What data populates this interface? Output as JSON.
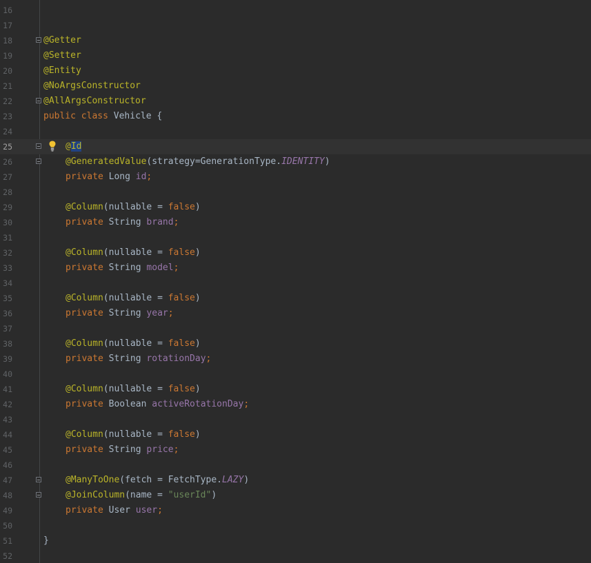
{
  "editor": {
    "current_line": "25",
    "lines": [
      {
        "num": "16",
        "text": ""
      },
      {
        "num": "17",
        "text": ""
      },
      {
        "num": "18",
        "annotation": "@Getter"
      },
      {
        "num": "19",
        "annotation": "@Setter"
      },
      {
        "num": "20",
        "annotation": "@Entity"
      },
      {
        "num": "21",
        "annotation": "@NoArgsConstructor"
      },
      {
        "num": "22",
        "annotation": "@AllArgsConstructor"
      },
      {
        "num": "23",
        "kw1": "public",
        "kw2": "class",
        "name": "Vehicle {"
      },
      {
        "num": "24",
        "text": ""
      },
      {
        "num": "25",
        "at": "@",
        "sel": "Id"
      },
      {
        "num": "26",
        "annotation": "@GeneratedValue",
        "args": "(strategy=GenerationType.",
        "constant": "IDENTITY",
        "close": ")"
      },
      {
        "num": "27",
        "kw": "private",
        "type": "Long",
        "field": "id",
        "semi": ";"
      },
      {
        "num": "28",
        "text": ""
      },
      {
        "num": "29",
        "annotation": "@Column",
        "args": "(nullable = ",
        "val": "false",
        "close": ")"
      },
      {
        "num": "30",
        "kw": "private",
        "type": "String",
        "field": "brand",
        "semi": ";"
      },
      {
        "num": "31",
        "text": ""
      },
      {
        "num": "32",
        "annotation": "@Column",
        "args": "(nullable = ",
        "val": "false",
        "close": ")"
      },
      {
        "num": "33",
        "kw": "private",
        "type": "String",
        "field": "model",
        "semi": ";"
      },
      {
        "num": "34",
        "text": ""
      },
      {
        "num": "35",
        "annotation": "@Column",
        "args": "(nullable = ",
        "val": "false",
        "close": ")"
      },
      {
        "num": "36",
        "kw": "private",
        "type": "String",
        "field": "year",
        "semi": ";"
      },
      {
        "num": "37",
        "text": ""
      },
      {
        "num": "38",
        "annotation": "@Column",
        "args": "(nullable = ",
        "val": "false",
        "close": ")"
      },
      {
        "num": "39",
        "kw": "private",
        "type": "String",
        "field": "rotationDay",
        "semi": ";"
      },
      {
        "num": "40",
        "text": ""
      },
      {
        "num": "41",
        "annotation": "@Column",
        "args": "(nullable = ",
        "val": "false",
        "close": ")"
      },
      {
        "num": "42",
        "kw": "private",
        "type": "Boolean",
        "field": "activeRotationDay",
        "semi": ";"
      },
      {
        "num": "43",
        "text": ""
      },
      {
        "num": "44",
        "annotation": "@Column",
        "args": "(nullable = ",
        "val": "false",
        "close": ")"
      },
      {
        "num": "45",
        "kw": "private",
        "type": "String",
        "field": "price",
        "semi": ";"
      },
      {
        "num": "46",
        "text": ""
      },
      {
        "num": "47",
        "annotation": "@ManyToOne",
        "args": "(fetch = FetchType.",
        "constant": "LAZY",
        "close": ")"
      },
      {
        "num": "48",
        "annotation": "@JoinColumn",
        "args": "(name = ",
        "string": "\"userId\"",
        "close": ")"
      },
      {
        "num": "49",
        "kw": "private",
        "type": "User",
        "field": "user",
        "semi": ";"
      },
      {
        "num": "50",
        "text": ""
      },
      {
        "num": "51",
        "brace": "}"
      },
      {
        "num": "52",
        "text": ""
      }
    ]
  },
  "colors": {
    "background": "#2b2b2b",
    "annotation": "#bbb529",
    "keyword": "#cc7832",
    "field": "#9876aa",
    "string": "#6a8759",
    "text": "#a9b7c6",
    "selection": "#214283"
  },
  "icons": {
    "intention_bulb": "lightbulb-icon",
    "fold_marker": "fold-marker-icon"
  }
}
